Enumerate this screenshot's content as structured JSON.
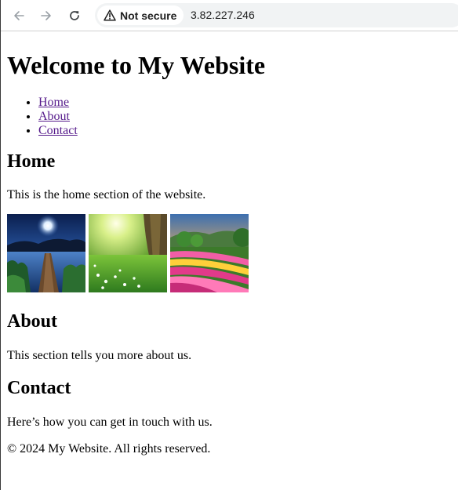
{
  "browser": {
    "security_label": "Not secure",
    "url": "3.82.227.246",
    "icons": [
      "back-arrow-icon",
      "forward-arrow-icon",
      "reload-icon",
      "warning-icon"
    ]
  },
  "page": {
    "title": "Welcome to My Website",
    "nav": [
      {
        "label": "Home"
      },
      {
        "label": "About"
      },
      {
        "label": "Contact"
      }
    ],
    "home": {
      "heading": "Home",
      "text": "This is the home section of the website.",
      "images": [
        {
          "subject": "moonlit lake with wooden pier"
        },
        {
          "subject": "sunlit forest meadow with flowers"
        },
        {
          "subject": "colorful flower field at sunset"
        }
      ]
    },
    "about": {
      "heading": "About",
      "text": "This section tells you more about us."
    },
    "contact": {
      "heading": "Contact",
      "text": "Here’s how you can get in touch with us."
    },
    "footer": {
      "text": "© 2024 My Website. All rights reserved."
    }
  },
  "colors": {
    "link": "#551a8b",
    "omnibox_bg": "#f1f3f4",
    "icon_gray": "#5f6368",
    "disabled_gray": "#9aa0a6"
  }
}
